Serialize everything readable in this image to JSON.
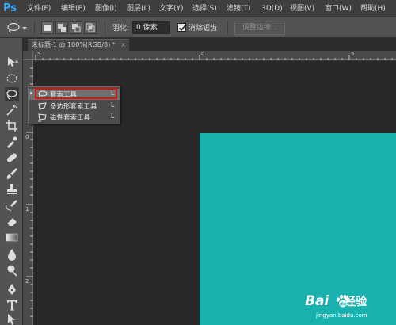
{
  "app": {
    "logo_text": "Ps",
    "menu": [
      "文件(F)",
      "编辑(E)",
      "图像(I)",
      "图层(L)",
      "文字(Y)",
      "选择(S)",
      "滤镜(T)",
      "3D(D)",
      "视图(V)",
      "窗口(W)",
      "帮助(H)"
    ]
  },
  "options_bar": {
    "feather_label": "羽化:",
    "feather_value": "0 像素",
    "antialias_label": "消除锯齿",
    "antialias_checked": true,
    "refine_edge_label": "调整边缘..."
  },
  "document": {
    "tab_title": "未标题-1 @ 100%(RGB/8) *",
    "tab_close": "×",
    "canvas_color": "#19b1ad"
  },
  "rulers": {
    "top": [
      "5",
      "0",
      "5"
    ],
    "left": [
      "0",
      "1",
      "2"
    ]
  },
  "flyout": {
    "items": [
      {
        "label": "套索工具",
        "shortcut": "L",
        "icon": "lasso-icon",
        "selected": true
      },
      {
        "label": "多边形套索工具",
        "shortcut": "L",
        "icon": "polygonal-lasso-icon",
        "selected": false
      },
      {
        "label": "磁性套索工具",
        "shortcut": "L",
        "icon": "magnetic-lasso-icon",
        "selected": false
      }
    ]
  },
  "watermark": {
    "brand_left": "Bai",
    "brand_right": "经验",
    "url": "jingyan.baidu.com"
  }
}
